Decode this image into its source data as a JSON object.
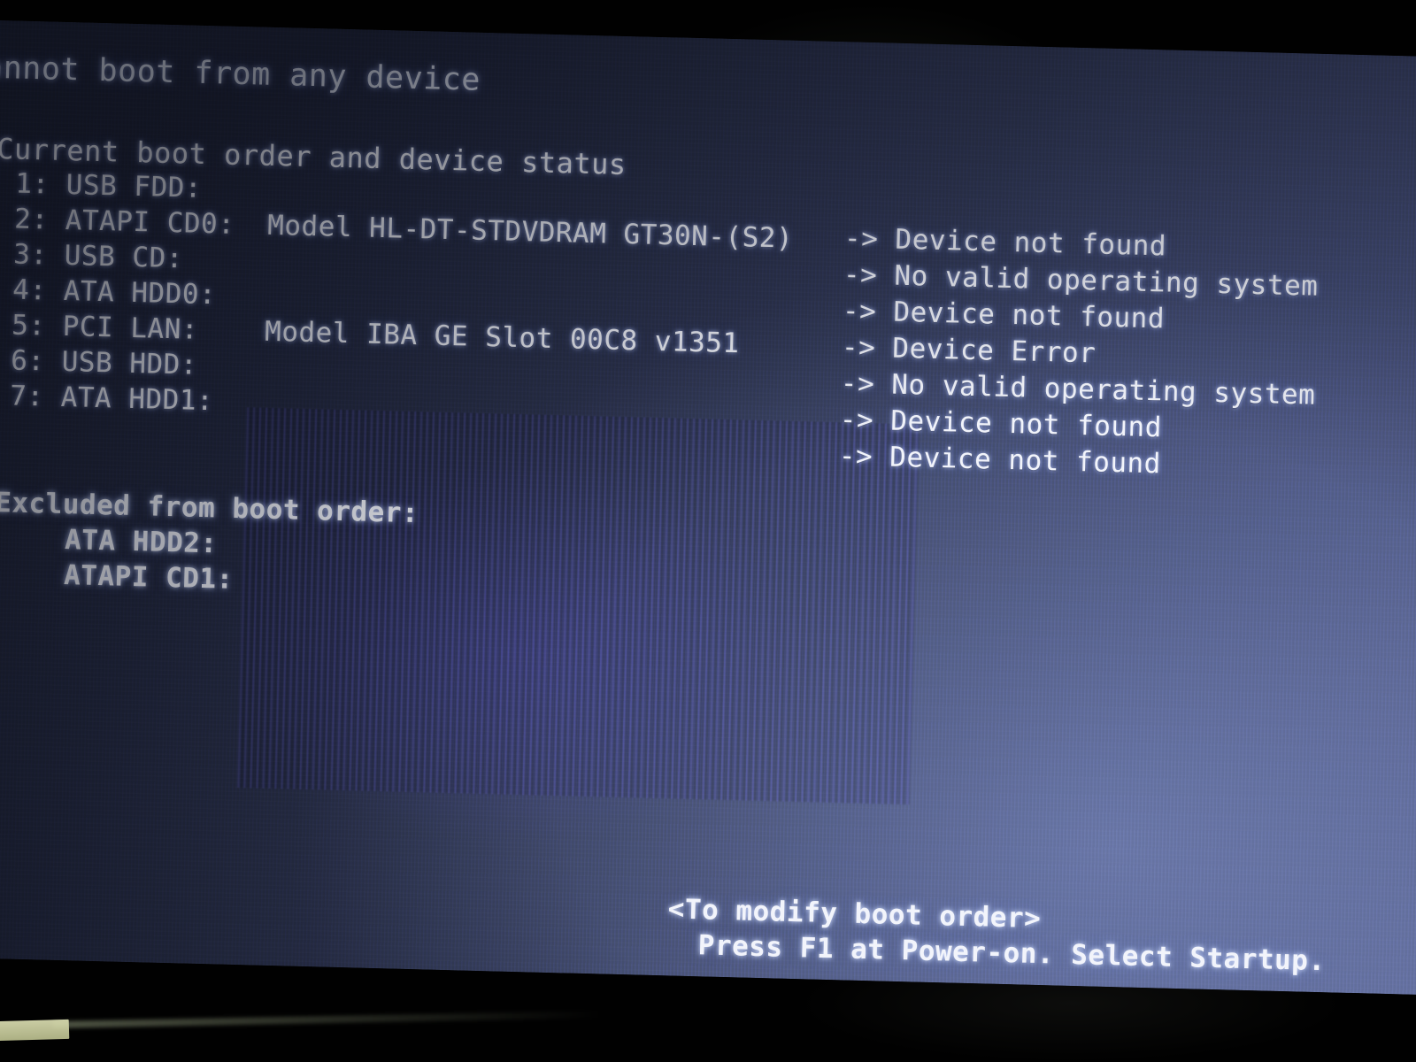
{
  "screen": {
    "title": "Cannot boot from any device",
    "section_heading": "Current boot order and device status",
    "boot_order": [
      {
        "index": "1:",
        "device": "USB FDD:",
        "model": "",
        "status": "-> Device not found"
      },
      {
        "index": "2:",
        "device": "ATAPI CD0:",
        "model": "Model HL-DT-STDVDRAM GT30N-(S2)",
        "status": "-> No valid operating system"
      },
      {
        "index": "3:",
        "device": "USB CD:",
        "model": "",
        "status": "-> Device not found"
      },
      {
        "index": "4:",
        "device": "ATA HDD0:",
        "model": "",
        "status": "-> Device Error"
      },
      {
        "index": "5:",
        "device": "PCI LAN:",
        "model": "Model IBA GE Slot 00C8 v1351",
        "status": "-> No valid operating system"
      },
      {
        "index": "6:",
        "device": "USB HDD:",
        "model": "",
        "status": "-> Device not found"
      },
      {
        "index": "7:",
        "device": "ATA HDD1:",
        "model": "",
        "status": "-> Device not found"
      }
    ],
    "excluded_heading": "Excluded from boot order:",
    "excluded": [
      {
        "device": "ATA HDD2:"
      },
      {
        "device": "ATAPI CD1:"
      }
    ],
    "footer": {
      "line1": "<To modify boot order>",
      "line2": "Press F1 at Power-on. Select Startup."
    }
  },
  "colors": {
    "screen_dark": "#1d2233",
    "screen_light": "#5b6590",
    "text": "#f2f4fb",
    "bezel": "#010101",
    "moire_purple": "#5854be"
  }
}
